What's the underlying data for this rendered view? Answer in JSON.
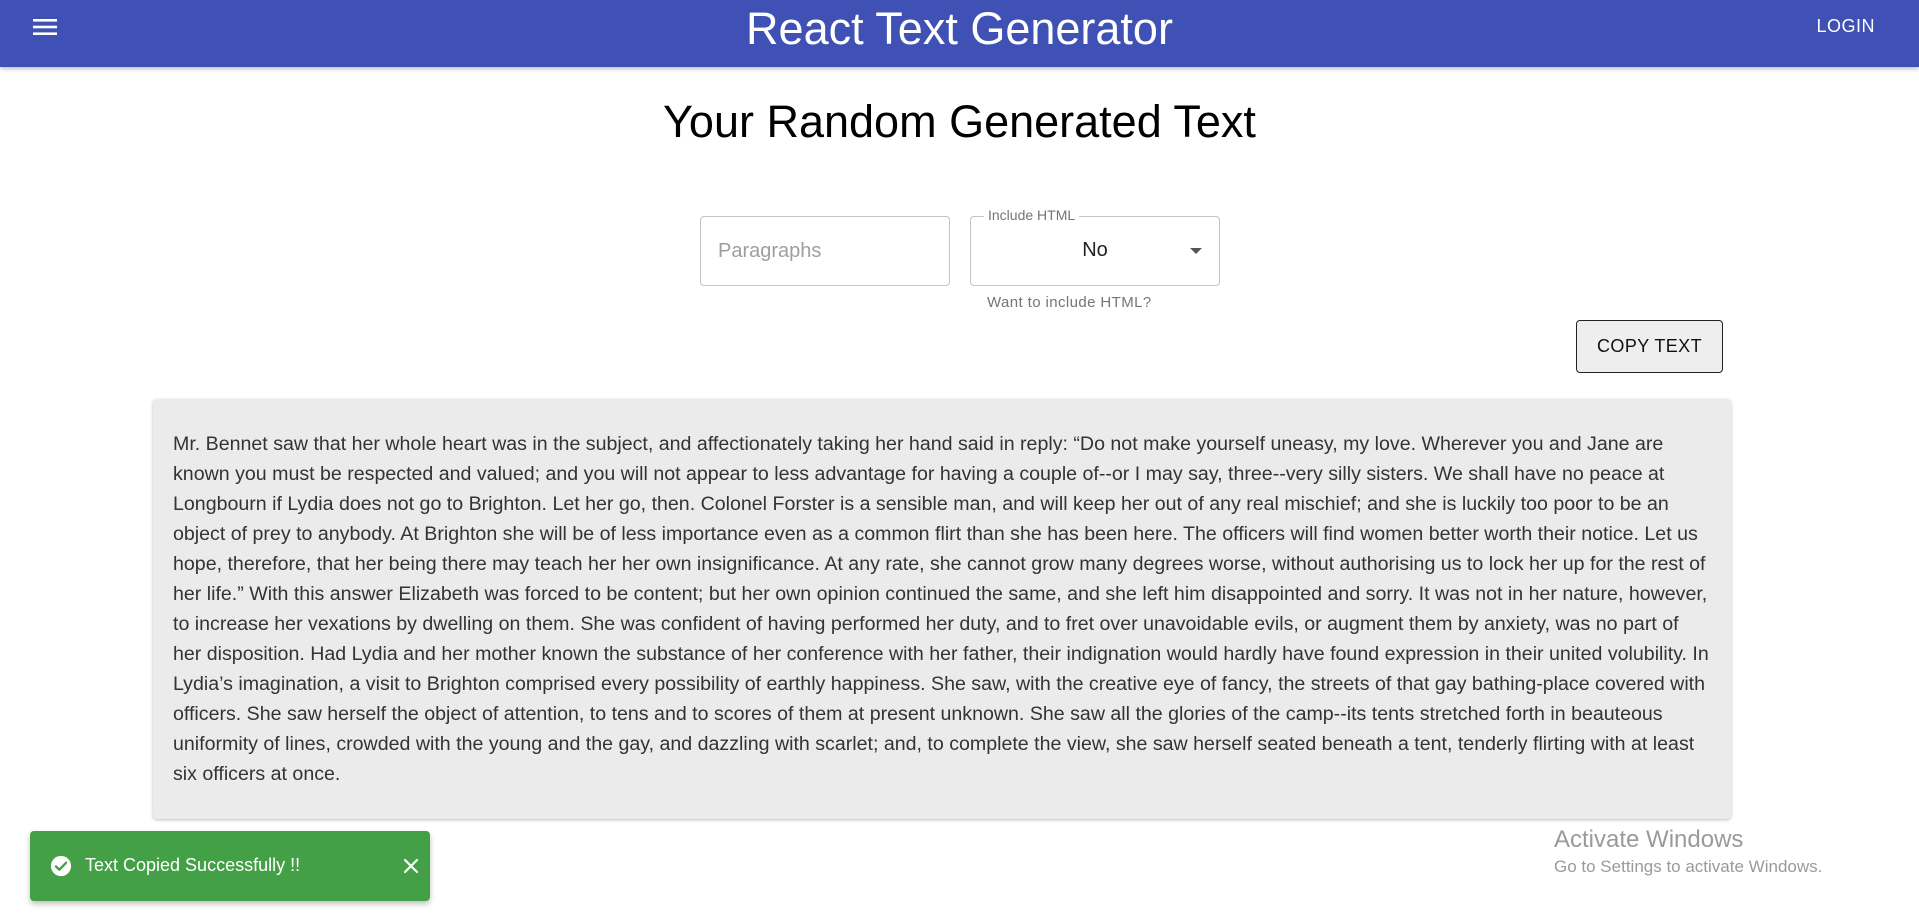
{
  "header": {
    "title": "React Text Generator",
    "login_label": "LOGIN",
    "menu_icon": "hamburger-menu-icon",
    "background_color": "#3f51b5"
  },
  "main": {
    "title": "Your Random Generated Text",
    "paragraphs_input": {
      "placeholder": "Paragraphs",
      "value": ""
    },
    "include_html": {
      "label": "Include HTML",
      "selected": "No",
      "helper_text": "Want to include HTML?"
    },
    "copy_button_label": "COPY TEXT",
    "generated_text": "Mr. Bennet saw that her whole heart was in the subject, and affectionately taking her hand said in reply: “Do not make yourself uneasy, my love. Wherever you and Jane are known you must be respected and valued; and you will not appear to less advantage for having a couple of--or I may say, three--very silly sisters. We shall have no peace at Longbourn if Lydia does not go to Brighton. Let her go, then. Colonel Forster is a sensible man, and will keep her out of any real mischief; and she is luckily too poor to be an object of prey to anybody. At Brighton she will be of less importance even as a common flirt than she has been here. The officers will find women better worth their notice. Let us hope, therefore, that her being there may teach her her own insignificance. At any rate, she cannot grow many degrees worse, without authorising us to lock her up for the rest of her life.” With this answer Elizabeth was forced to be content; but her own opinion continued the same, and she left him disappointed and sorry. It was not in her nature, however, to increase her vexations by dwelling on them. She was confident of having performed her duty, and to fret over unavoidable evils, or augment them by anxiety, was no part of her disposition. Had Lydia and her mother known the substance of her conference with her father, their indignation would hardly have found expression in their united volubility. In Lydia’s imagination, a visit to Brighton comprised every possibility of earthly happiness. She saw, with the creative eye of fancy, the streets of that gay bathing-place covered with officers. She saw herself the object of attention, to tens and to scores of them at present unknown. She saw all the glories of the camp--its tents stretched forth in beauteous uniformity of lines, crowded with the young and the gay, and dazzling with scarlet; and, to complete the view, she saw herself seated beneath a tent, tenderly flirting with at least six officers at once."
  },
  "toast": {
    "message": "Text Copied Successfully !!",
    "icon": "check-circle-icon",
    "close_icon": "close-icon",
    "color": "#43a047"
  },
  "watermark": {
    "title": "Activate Windows",
    "subtitle": "Go to Settings to activate Windows."
  }
}
